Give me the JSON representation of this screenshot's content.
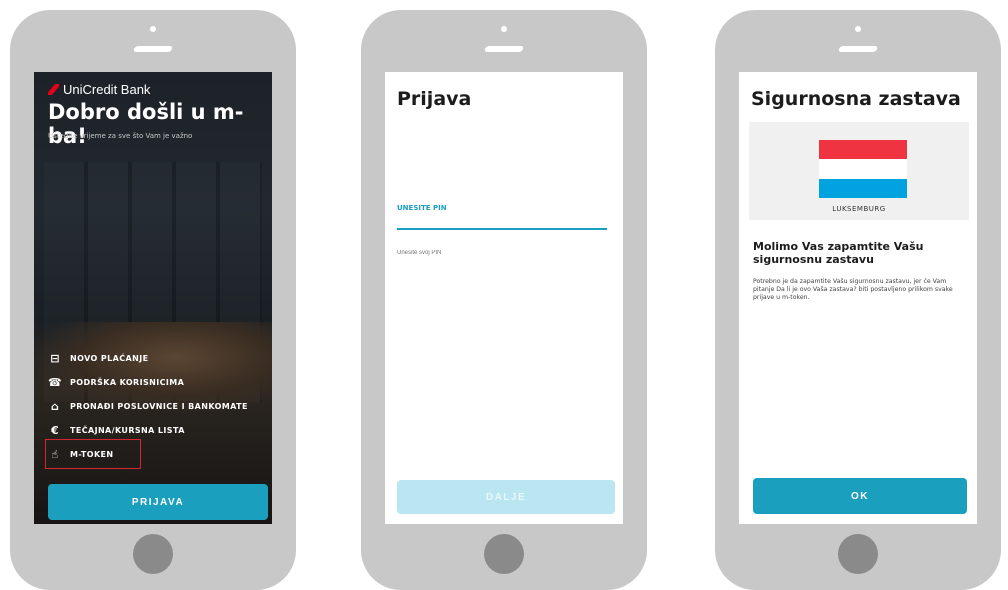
{
  "screen1": {
    "brand": "UniCredit Bank",
    "welcome": "Dobro došli u m-ba!",
    "subtitle": "Uštedite vrijeme za sve što Vam je važno",
    "menu": [
      {
        "label": "NOVO PLAĆANJE",
        "icon": "payment-icon",
        "glyph": "⊟"
      },
      {
        "label": "PODRŠKA KORISNICIMA",
        "icon": "support-icon",
        "glyph": "☎"
      },
      {
        "label": "PRONAĐI POSLOVNICE I BANKOMATE",
        "icon": "location-icon",
        "glyph": "⌂"
      },
      {
        "label": "TEČAJNA/KURSNA LISTA",
        "icon": "currency-icon",
        "glyph": "€"
      },
      {
        "label": "M-TOKEN",
        "icon": "token-icon",
        "glyph": "☝"
      }
    ],
    "login_button": "PRIJAVA"
  },
  "screen2": {
    "title": "Prijava",
    "pin_label": "UNESITE PIN",
    "pin_placeholder": "Unesite svoj PIN",
    "next_button": "DALJE"
  },
  "screen3": {
    "title": "Sigurnosna zastava",
    "country": "LUKSEMBURG",
    "flag_colors": [
      "#ef3340",
      "#ffffff",
      "#00a3e0"
    ],
    "heading": "Molimo Vas zapamtite Vašu sigurnosnu zastavu",
    "body": "Potrebno je da zapamtite Vašu sigurnosnu zastavu, jer će Vam pitanje Da li je ovo Vaša zastava? biti postavljeno prilikom svake prijave u m-token.",
    "ok_button": "OK"
  },
  "colors": {
    "accent": "#1b9fbf",
    "accent_disabled": "#b9e6f1",
    "brand_red": "#e2001a",
    "highlight": "#d9262e"
  }
}
